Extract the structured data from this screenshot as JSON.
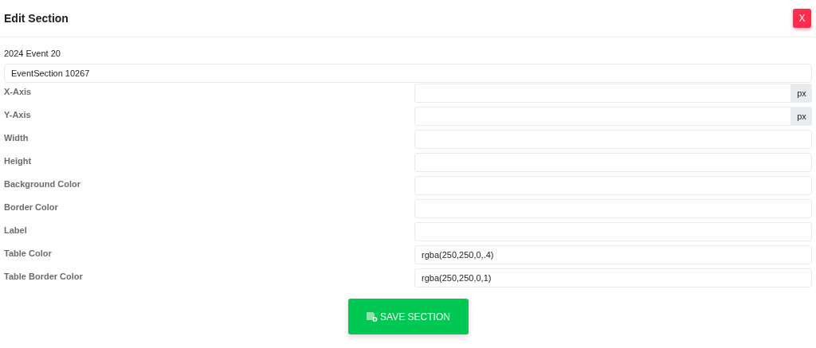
{
  "dialog": {
    "title": "Edit Section",
    "close_button": "X"
  },
  "event_label": "2024 Event 20",
  "name_field": {
    "value": "EventSection 10267"
  },
  "fields": [
    {
      "label": "X-Axis",
      "suffix": "px"
    },
    {
      "label": "Y-Axis",
      "suffix": "px"
    },
    {
      "label": "Width"
    },
    {
      "label": "Height"
    },
    {
      "label": "Background Color"
    },
    {
      "label": "Border Color"
    },
    {
      "label": "Label"
    },
    {
      "label": "Table Color",
      "value": "rgba(250,250,0,.4)"
    },
    {
      "label": "Table Border Color",
      "value": "rgba(250,250,0,1)"
    }
  ],
  "save_button": "SAVE SECTION"
}
